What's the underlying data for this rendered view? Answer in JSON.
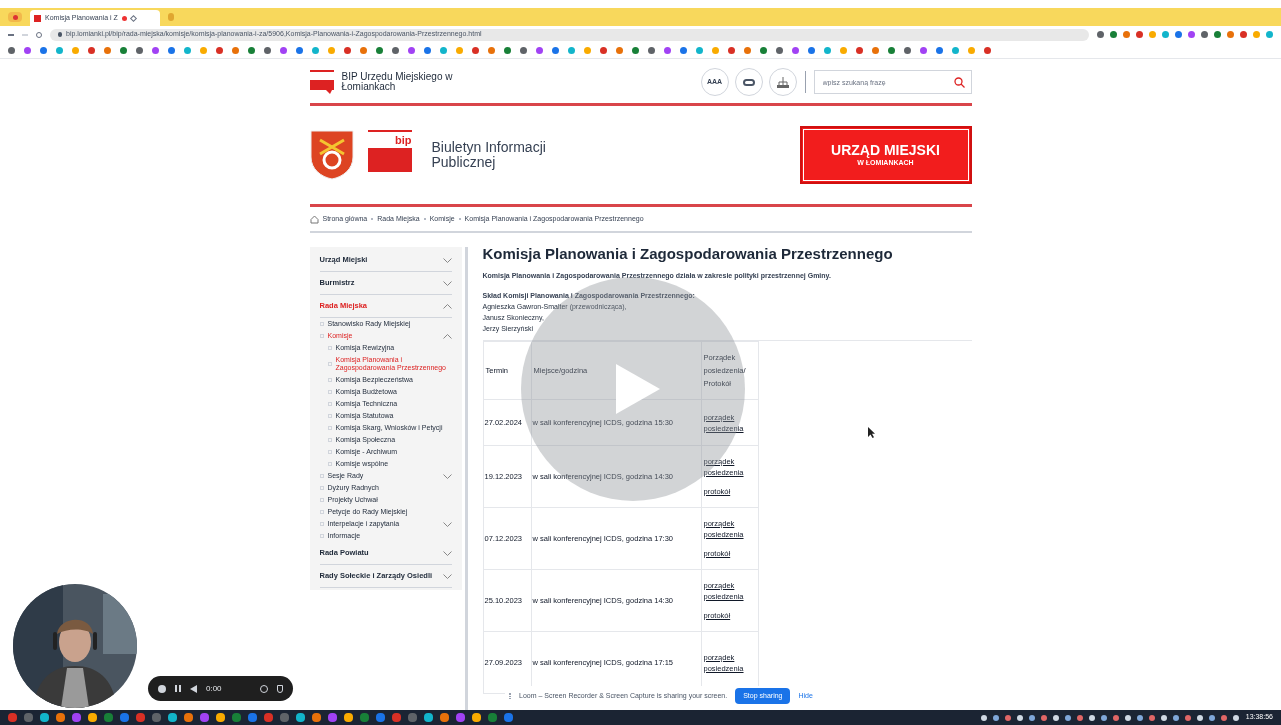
{
  "browser": {
    "tab_title": "Komisja Planowania i Z",
    "url": "bip.lomianki.pl/bip/rada-miejska/komisje/komisja-planowania-i-za/5906,Komisja-Planowania-i-Zagospodarowania-Przestrzennego.html"
  },
  "header": {
    "site_name": "BIP Urzędu Miejskiego w Łomiankach",
    "font_size_button": "AAA",
    "search": {
      "placeholder": "wpisz szukaną frazę"
    },
    "bip_logo": "bip",
    "title": "Biuletyn Informacji Publicznej",
    "banner_line1": "URZĄD MIEJSKI",
    "banner_line2": "W ŁOMIANKACH"
  },
  "breadcrumb": [
    "Strona główna",
    "Rada Miejska",
    "Komisje",
    "Komisja Planowania i Zagospodarowania Przestrzennego"
  ],
  "sidebar": {
    "items": [
      {
        "label": "Urząd Miejski",
        "kind": "folder",
        "selected": false,
        "expanded": false
      },
      {
        "label": "Burmistrz",
        "kind": "folder",
        "selected": false,
        "expanded": false
      },
      {
        "label": "Rada Miejska",
        "kind": "folder",
        "selected": true,
        "expanded": true,
        "children": [
          {
            "label": "Stanowisko Rady Miejskiej",
            "kind": "page",
            "selected": false,
            "expanded": false
          },
          {
            "label": "Komisje",
            "kind": "folder",
            "selected": true,
            "expanded": true,
            "children": [
              {
                "label": "Komisja Rewizyjna",
                "kind": "page",
                "selected": false,
                "expanded": false
              },
              {
                "label": "Komisja Planowania i Zagospodarowania Przestrzennego",
                "kind": "page",
                "selected": true,
                "expanded": false
              },
              {
                "label": "Komisja Bezpieczeństwa",
                "kind": "page",
                "selected": false,
                "expanded": false
              },
              {
                "label": "Komisja Budżetowa",
                "kind": "page",
                "selected": false,
                "expanded": false
              },
              {
                "label": "Komisja Techniczna",
                "kind": "page",
                "selected": false,
                "expanded": false
              },
              {
                "label": "Komisja Statutowa",
                "kind": "page",
                "selected": false,
                "expanded": false
              },
              {
                "label": "Komisja Skarg, Wniosków i Petycji",
                "kind": "page",
                "selected": false,
                "expanded": false
              },
              {
                "label": "Komisja Społeczna",
                "kind": "page",
                "selected": false,
                "expanded": false
              },
              {
                "label": "Komisje - Archiwum",
                "kind": "page",
                "selected": false,
                "expanded": false
              },
              {
                "label": "Komisje wspólne",
                "kind": "page",
                "selected": false,
                "expanded": false
              }
            ]
          },
          {
            "label": "Sesje Rady",
            "kind": "folder",
            "selected": false,
            "expanded": false
          },
          {
            "label": "Dyżury Radnych",
            "kind": "page",
            "selected": false,
            "expanded": false
          },
          {
            "label": "Projekty Uchwał",
            "kind": "page",
            "selected": false,
            "expanded": false
          },
          {
            "label": "Petycje do Rady Miejskiej",
            "kind": "page",
            "selected": false,
            "expanded": false
          },
          {
            "label": "Interpelacje i zapytania",
            "kind": "folder",
            "selected": false,
            "expanded": false
          },
          {
            "label": "Informacje",
            "kind": "page",
            "selected": false,
            "expanded": false
          }
        ]
      },
      {
        "label": "Rada Powiatu",
        "kind": "folder",
        "selected": false,
        "expanded": false
      },
      {
        "label": "Rady Sołeckie i Zarządy Osiedli",
        "kind": "folder",
        "selected": false,
        "expanded": false
      }
    ]
  },
  "content": {
    "title": "Komisja Planowania i Zagospodarowania Przestrzennego",
    "intro": "Komisja Planowania i Zagospodarowania Przestrzennego działa w zakresie polityki przestrzennej Gminy.",
    "members_heading": "Skład Komisji Planowania i Zagospodarowania Przestrzennego:",
    "members": [
      "Agnieszka Gawron-Smalter (przewodnicząca),",
      "Janusz Skonieczny,",
      "Jerzy Sierzyński"
    ],
    "table": {
      "columns": [
        "Termin",
        "Miejsce/godzina",
        "Porządek posiedzenia/ Protokół"
      ],
      "rows": [
        {
          "date": "27.02.2024",
          "place": "w sali konferencyjnej ICDS, godzina 15:30",
          "links": [
            "porządek posiedzenia"
          ]
        },
        {
          "date": "19.12.2023",
          "place": "w sali konferencyjnej ICDS, godzina 14:30",
          "links": [
            "porządek posiedzenia",
            "protokół"
          ]
        },
        {
          "date": "07.12.2023",
          "place": "w sali konferencyjnej ICDS, godzina 17:30",
          "links": [
            "porządek posiedzenia",
            "protokół"
          ]
        },
        {
          "date": "25.10.2023",
          "place": "w sali konferencyjnej ICDS, godzina 14:30",
          "links": [
            "porządek posiedzenia",
            "protokół"
          ]
        },
        {
          "date": "27.09.2023",
          "place": "w sali konferencyjnej ICDS, godzina 17:15",
          "links": [
            "porządek posiedzenia"
          ]
        }
      ]
    }
  },
  "recorder": {
    "time": "0:00"
  },
  "sharing_bar": {
    "message": "Loom – Screen Recorder & Screen Capture is sharing your screen.",
    "stop_button": "Stop sharing",
    "hide_link": "Hide"
  },
  "taskbar": {
    "clock": "13:38:56"
  }
}
